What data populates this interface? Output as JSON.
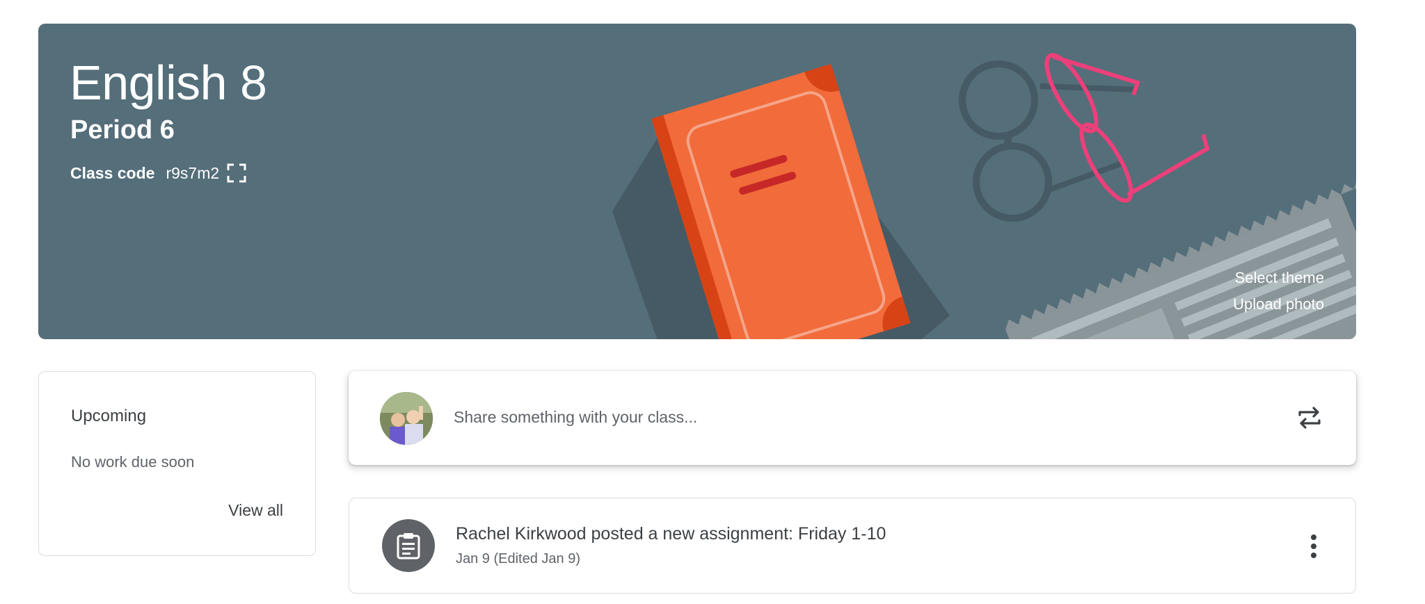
{
  "course": {
    "title": "English 8",
    "section": "Period 6",
    "class_code_label": "Class code",
    "class_code": "r9s7m2"
  },
  "banner": {
    "select_theme": "Select theme",
    "upload_photo": "Upload photo",
    "background_color": "#546e7a",
    "illustration_icon": "book-glasses-newspaper-illustration"
  },
  "upcoming": {
    "title": "Upcoming",
    "empty_text": "No work due soon",
    "view_all": "View all"
  },
  "share": {
    "placeholder": "Share something with your class...",
    "repost_icon": "repost-icon"
  },
  "stream": {
    "posts": [
      {
        "title": "Rachel Kirkwood posted a new assignment: Friday 1-10",
        "date": "Jan 9 (Edited Jan 9)",
        "icon": "assignment-icon"
      }
    ]
  },
  "colors": {
    "banner": "#546e7a",
    "book": "#f26b3a",
    "glasses_pink": "#ec407a",
    "text_primary": "#3c4043",
    "text_secondary": "#5f6368"
  }
}
